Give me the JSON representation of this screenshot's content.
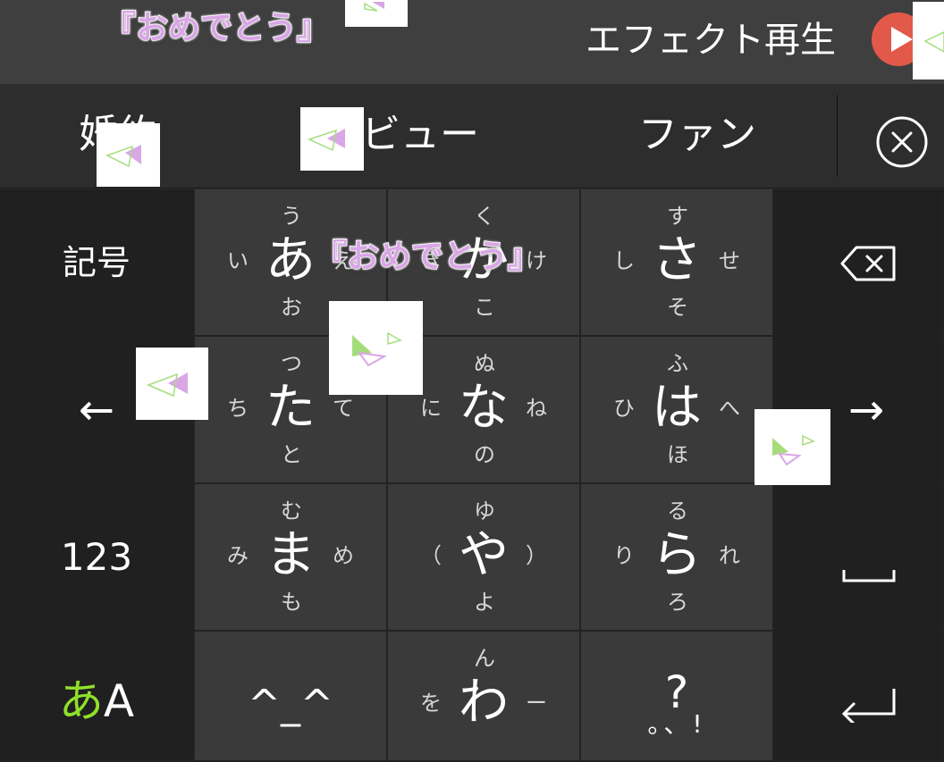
{
  "effect_bar": {
    "sticker_text": "『おめでとう』",
    "label": "エフェクト再生"
  },
  "candidates": [
    "婚約",
    "レビュー",
    "ファン"
  ],
  "keys": {
    "symbols": "記号",
    "left_arrow": "←",
    "right_arrow": "→",
    "numbers": "123",
    "mode_kana": "あ",
    "mode_alpha": "A",
    "emoticon": "^_^",
    "punct_main": "?",
    "punct_sub": "。、!",
    "a": {
      "main": "あ",
      "up": "う",
      "left": "い",
      "right": "え",
      "down": "お"
    },
    "ka": {
      "main": "か",
      "up": "く",
      "left": "き",
      "right": "け",
      "down": "こ"
    },
    "sa": {
      "main": "さ",
      "up": "す",
      "left": "し",
      "right": "せ",
      "down": "そ"
    },
    "ta": {
      "main": "た",
      "up": "つ",
      "left": "ち",
      "right": "て",
      "down": "と"
    },
    "na": {
      "main": "な",
      "up": "ぬ",
      "left": "に",
      "right": "ね",
      "down": "の"
    },
    "ha": {
      "main": "は",
      "up": "ふ",
      "left": "ひ",
      "right": "へ",
      "down": "ほ"
    },
    "ma": {
      "main": "ま",
      "up": "む",
      "left": "み",
      "right": "め",
      "down": "も"
    },
    "ya": {
      "main": "や",
      "up": "ゆ",
      "left": "（",
      "right": "）",
      "down": "よ"
    },
    "ra": {
      "main": "ら",
      "up": "る",
      "left": "り",
      "right": "れ",
      "down": "ろ"
    },
    "wa": {
      "main": "わ",
      "up": "ん",
      "left": "を",
      "right": "ー"
    }
  },
  "colors": {
    "play_button": "#e2594a",
    "mode_kana": "#8fe02a",
    "key_main": "#3a3a3a",
    "key_fn": "#202020",
    "sticker_pink": "#d9a6e6",
    "sticker_green": "#a6dd7c"
  },
  "icons": {
    "play": "play-icon",
    "close": "close-circle-icon",
    "backspace": "backspace-icon",
    "space": "space-icon",
    "enter": "enter-icon",
    "sticker": "triangle-sticker-icon"
  }
}
